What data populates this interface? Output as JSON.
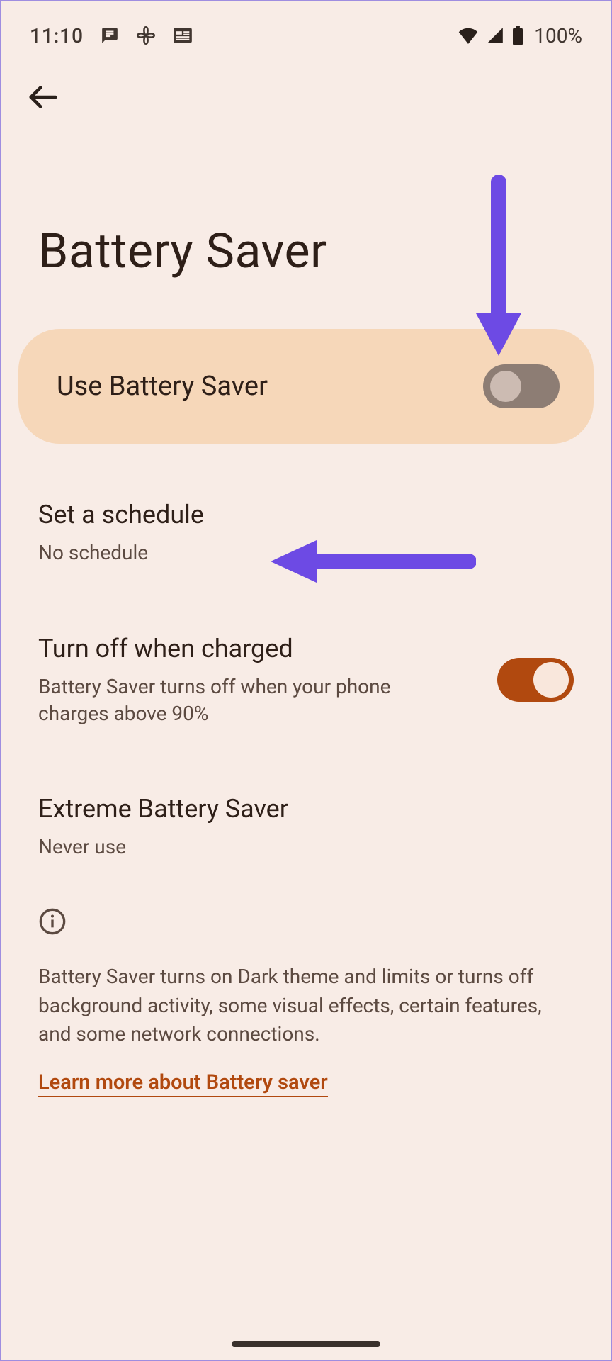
{
  "status": {
    "time": "11:10",
    "battery_text": "100%"
  },
  "nav": {
    "back_label": "Back"
  },
  "page": {
    "title": "Battery Saver"
  },
  "main_toggle": {
    "label": "Use Battery Saver",
    "state": "off"
  },
  "items": {
    "schedule": {
      "title": "Set a schedule",
      "sub": "No schedule"
    },
    "turn_off": {
      "title": "Turn off when charged",
      "sub": "Battery Saver turns off when your phone charges above 90%",
      "state": "on"
    },
    "extreme": {
      "title": "Extreme Battery Saver",
      "sub": "Never use"
    }
  },
  "info": {
    "text": "Battery Saver turns on Dark theme and limits or turns off background activity, some visual effects, certain features, and some network connections.",
    "link_label": "Learn more about Battery saver"
  },
  "annotations": {
    "arrow_top": "Arrow pointing to Use Battery Saver toggle",
    "arrow_left": "Arrow pointing to Set a schedule"
  }
}
